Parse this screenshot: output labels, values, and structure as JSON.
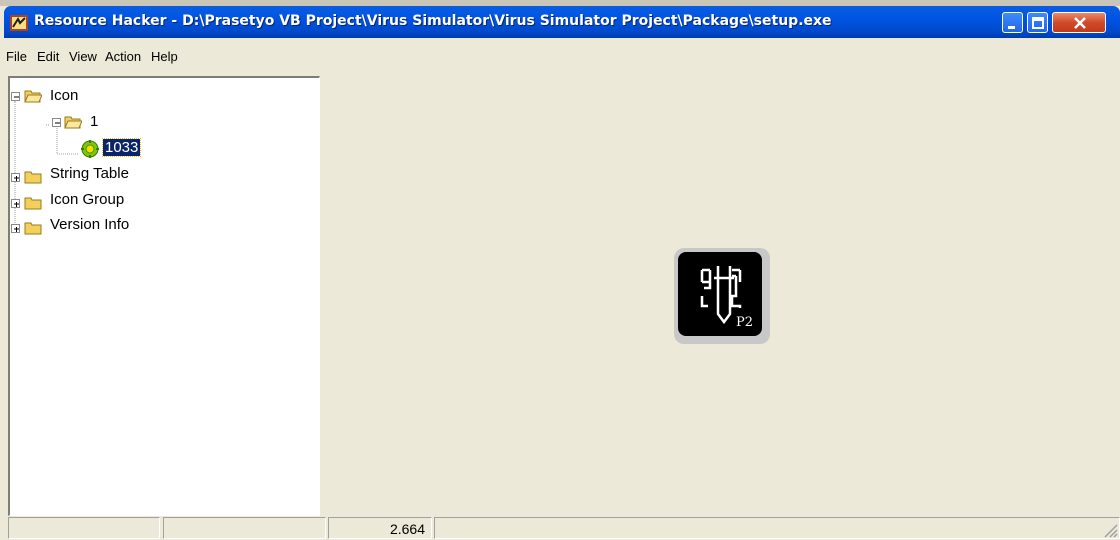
{
  "window": {
    "title": "Resource Hacker  -  D:\\Prasetyo VB Project\\Virus Simulator\\Virus Simulator Project\\Package\\setup.exe"
  },
  "menu": [
    "File",
    "Edit",
    "View",
    "Action",
    "Help"
  ],
  "tree": {
    "nodes": [
      {
        "label": "Icon",
        "expanded": true
      },
      {
        "label": "1",
        "expanded": true
      },
      {
        "label": "1033",
        "selected": true
      },
      {
        "label": "String Table",
        "expanded": false
      },
      {
        "label": "Icon Group",
        "expanded": false
      },
      {
        "label": "Version Info",
        "expanded": false
      }
    ]
  },
  "preview": {
    "icon": "resource-icon-p2",
    "icon_caption": "P2"
  },
  "status": {
    "cells": [
      "",
      "",
      "2.664",
      ""
    ]
  },
  "colors": {
    "titlebar": "#0054e3",
    "selection": "#0a246a",
    "folder": "#f3d05a",
    "face": "#ece9d8"
  }
}
